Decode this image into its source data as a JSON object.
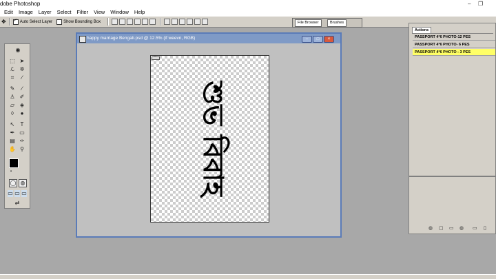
{
  "window": {
    "title": "dobe Photoshop",
    "controls": [
      "–",
      "❐"
    ]
  },
  "menu": [
    "Edit",
    "Image",
    "Layer",
    "Select",
    "Filter",
    "View",
    "Window",
    "Help"
  ],
  "options": {
    "auto_select": "Auto Select Layer",
    "show_bounding": "Show Bounding Box"
  },
  "palette_well": {
    "tabs": [
      "File Browser",
      "Brushes"
    ]
  },
  "document": {
    "title": "happy marriage Bengali.psd @ 12.5% (if weevn, RGB)",
    "controls": [
      "–",
      "□",
      "×"
    ],
    "canvas_text": "শুভ বিবাহ"
  },
  "actions_panel": {
    "tab": "Actions",
    "items": [
      "PASSPORT 4*6 PHOTO-12 PES",
      "PASSPORT 4*6 PHOTO- 6 PES",
      "PASSPORT 4*6 PHOTO - 3 PES"
    ],
    "selected_index": 2,
    "highlight_color": "#ffff66"
  },
  "colors": {
    "background": "#a8a8a8",
    "doc_title": "#7f9ac6",
    "ui": "#d4d0c8"
  }
}
